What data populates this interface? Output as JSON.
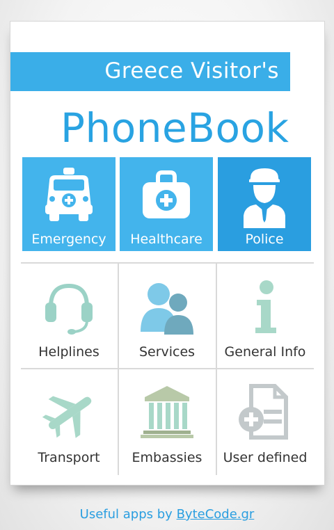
{
  "header": {
    "banner_text": "Greece Visitor's",
    "title": "PhoneBook"
  },
  "featured": [
    {
      "label": "Emergency",
      "icon": "ambulance-icon"
    },
    {
      "label": "Healthcare",
      "icon": "first-aid-kit-icon"
    },
    {
      "label": "Police",
      "icon": "police-officer-icon"
    }
  ],
  "grid": [
    {
      "label": "Helplines",
      "icon": "headset-icon"
    },
    {
      "label": "Services",
      "icon": "people-icon"
    },
    {
      "label": "General Info",
      "icon": "info-icon"
    },
    {
      "label": "Transport",
      "icon": "airplane-icon"
    },
    {
      "label": "Embassies",
      "icon": "embassy-building-icon"
    },
    {
      "label": "User defined",
      "icon": "document-add-icon"
    }
  ],
  "footer": {
    "prefix": "Useful apps by ",
    "link": "ByteCode.gr"
  },
  "colors": {
    "accent": "#3aaee8",
    "accent_dark": "#2a9ee0",
    "teal_icon": "#9bd2c6",
    "label_text": "#333333"
  }
}
